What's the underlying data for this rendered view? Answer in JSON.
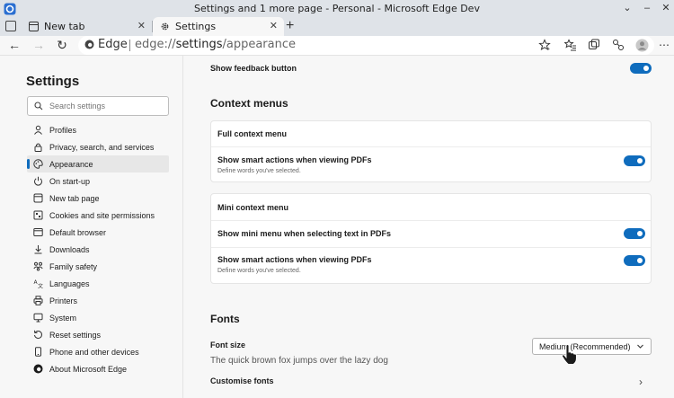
{
  "window": {
    "title": "Settings and 1 more page - Personal - Microsoft Edge Dev"
  },
  "tabs": [
    {
      "label": "New tab"
    },
    {
      "label": "Settings"
    }
  ],
  "toolbar": {
    "site_label": "Edge",
    "url_prefix": "edge://",
    "url_path_bold": "settings",
    "url_rest": "/appearance"
  },
  "sidebar": {
    "title": "Settings",
    "search_placeholder": "Search settings",
    "items": [
      {
        "label": "Profiles",
        "icon": "profile-icon"
      },
      {
        "label": "Privacy, search, and services",
        "icon": "lock-icon"
      },
      {
        "label": "Appearance",
        "icon": "palette-icon",
        "selected": true
      },
      {
        "label": "On start-up",
        "icon": "power-icon"
      },
      {
        "label": "New tab page",
        "icon": "new-tab-icon"
      },
      {
        "label": "Cookies and site permissions",
        "icon": "site-permissions-icon"
      },
      {
        "label": "Default browser",
        "icon": "browser-icon"
      },
      {
        "label": "Downloads",
        "icon": "download-icon"
      },
      {
        "label": "Family safety",
        "icon": "family-icon"
      },
      {
        "label": "Languages",
        "icon": "languages-icon"
      },
      {
        "label": "Printers",
        "icon": "printer-icon"
      },
      {
        "label": "System",
        "icon": "system-icon"
      },
      {
        "label": "Reset settings",
        "icon": "reset-icon"
      },
      {
        "label": "Phone and other devices",
        "icon": "phone-icon"
      },
      {
        "label": "About Microsoft Edge",
        "icon": "edge-logo-icon"
      }
    ]
  },
  "main": {
    "feedback": {
      "label": "Show feedback button",
      "on": true
    },
    "context_menus": {
      "title": "Context menus",
      "full_card": {
        "header": "Full context menu",
        "smart_actions": {
          "label": "Show smart actions when viewing PDFs",
          "sub": "Define words you've selected.",
          "on": true
        }
      },
      "mini_card": {
        "header": "Mini context menu",
        "mini_menu": {
          "label": "Show mini menu when selecting text in PDFs",
          "on": true
        },
        "smart_actions": {
          "label": "Show smart actions when viewing PDFs",
          "sub": "Define words you've selected.",
          "on": true
        }
      }
    },
    "fonts": {
      "title": "Fonts",
      "font_size_label": "Font size",
      "font_size_value": "Medium (Recommended)",
      "sample": "The quick brown fox jumps over the lazy dog",
      "customise_label": "Customise fonts"
    }
  },
  "colors": {
    "accent": "#0f6cbd"
  }
}
